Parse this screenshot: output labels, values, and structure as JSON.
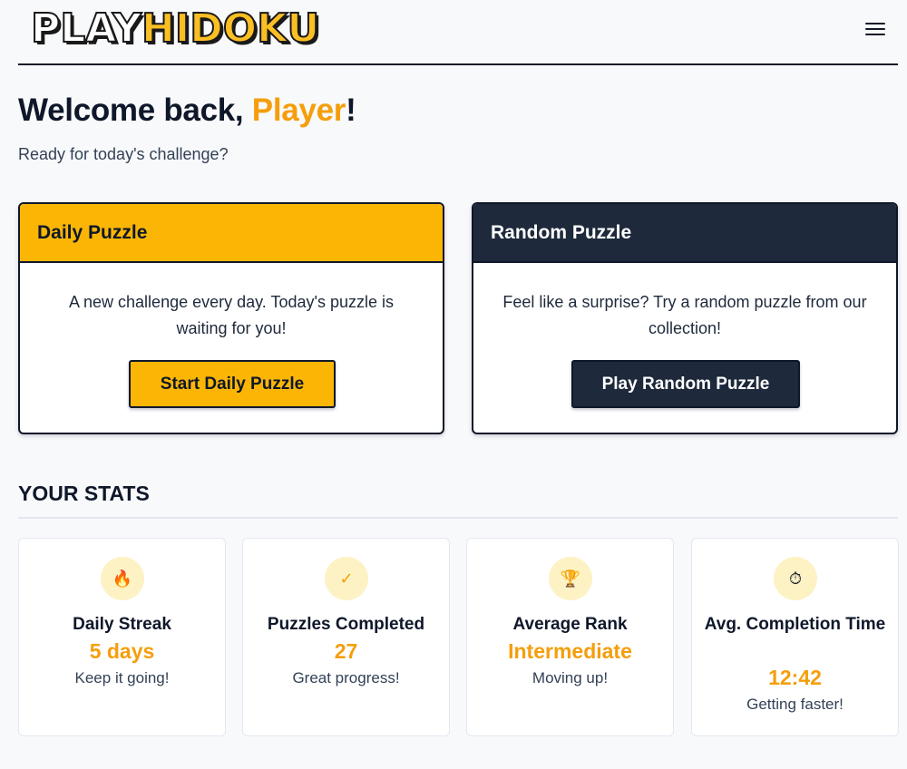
{
  "header": {
    "logo_part1": "PLAY",
    "logo_part2": "HIDOKU",
    "menu_icon": "hamburger-menu-icon"
  },
  "welcome": {
    "prefix": "Welcome back, ",
    "name": "Player",
    "suffix": "!",
    "subtitle": "Ready for today's challenge?"
  },
  "cards": {
    "daily": {
      "title": "Daily Puzzle",
      "description": "A new challenge every day. Today's puzzle is waiting for you!",
      "button": "Start Daily Puzzle"
    },
    "random": {
      "title": "Random Puzzle",
      "description": "Feel like a surprise? Try a random puzzle from our collection!",
      "button": "Play Random Puzzle"
    }
  },
  "stats": {
    "title": "YOUR STATS",
    "items": [
      {
        "icon": "fire-icon",
        "glyph": "🔥",
        "label": "Daily Streak",
        "value": "5 days",
        "note": "Keep it going!"
      },
      {
        "icon": "checkmark-icon",
        "glyph": "✓",
        "label": "Puzzles Completed",
        "value": "27",
        "note": "Great progress!"
      },
      {
        "icon": "trophy-icon",
        "glyph": "🏆",
        "label": "Average Rank",
        "value": "Intermediate",
        "note": "Moving up!"
      },
      {
        "icon": "stopwatch-icon",
        "glyph": "⏱",
        "label": "Avg. Completion Time",
        "value": "12:42",
        "note": "Getting faster!"
      }
    ]
  },
  "colors": {
    "accent": "#f59e0b",
    "daily_header": "#fbb605",
    "random_header": "#1e293b",
    "icon_bg": "#fdf2c4"
  }
}
